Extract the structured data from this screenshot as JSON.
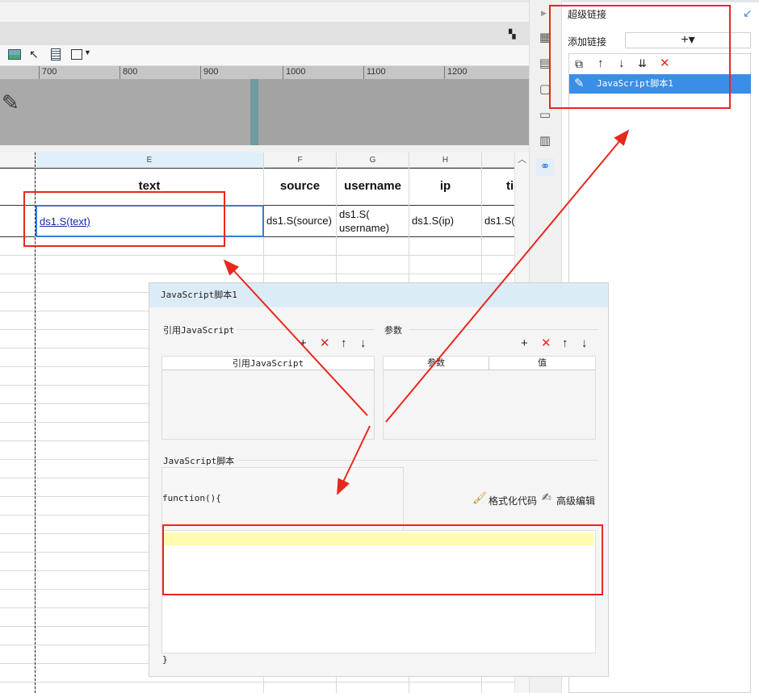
{
  "ruler": {
    "ticks": [
      "700",
      "800",
      "900",
      "1000",
      "1100",
      "1200"
    ]
  },
  "sheet": {
    "columns": [
      {
        "letter": "E",
        "header": "text",
        "value": "ds1.S(text)"
      },
      {
        "letter": "F",
        "header": "source",
        "value": "ds1.S(source)"
      },
      {
        "letter": "G",
        "header": "username",
        "value": "ds1.S(\nusername)"
      },
      {
        "letter": "H",
        "header": "ip",
        "value": "ds1.S(ip)"
      },
      {
        "letter": "",
        "header": "ti",
        "value": "ds1.S("
      }
    ]
  },
  "right_panel": {
    "title": "超级链接",
    "add_label": "添加链接",
    "add_button": "+▾",
    "item": "JavaScript脚本1"
  },
  "dialog": {
    "title": "JavaScript脚本1",
    "ref_section": "引用JavaScript",
    "ref_column": "引用JavaScript",
    "param_section": "参数",
    "param_col_1": "参数",
    "param_col_2": "值",
    "script_section": "JavaScript脚本",
    "func_open": "function(){",
    "func_close": "}",
    "format_code": "格式化代码",
    "advanced_edit": "高级编辑"
  },
  "colors": {
    "accent": "#3a8ee6",
    "annotation": "#e8271d",
    "highlight": "#fffbb0"
  }
}
